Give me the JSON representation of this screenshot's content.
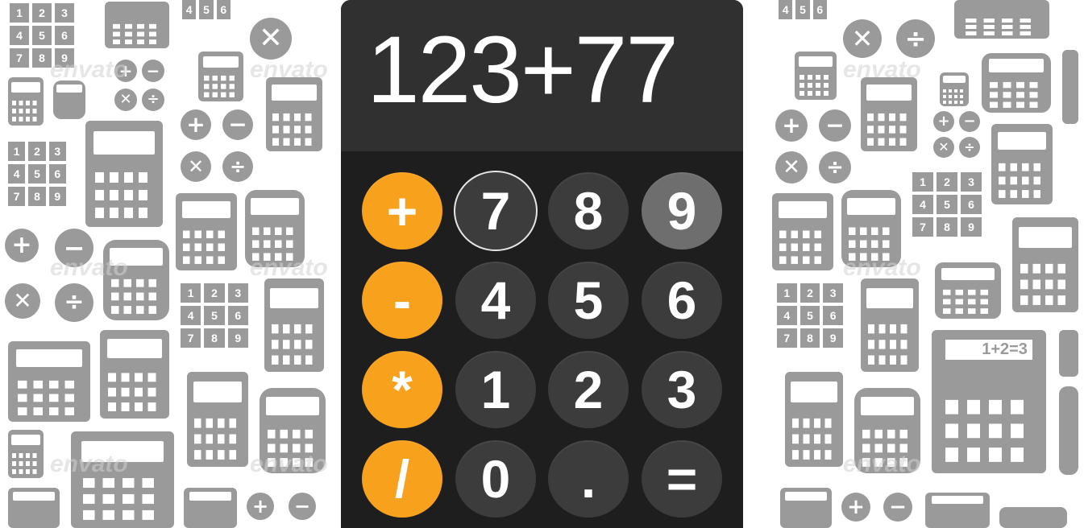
{
  "display": {
    "expression": "123+77"
  },
  "buttons": {
    "plus": "+",
    "minus": "-",
    "multiply": "*",
    "divide": "/",
    "seven": "7",
    "eight": "8",
    "nine": "9",
    "four": "4",
    "five": "5",
    "six": "6",
    "one": "1",
    "two": "2",
    "three": "3",
    "zero": "0",
    "dot": ".",
    "equals": "="
  },
  "background": {
    "watermark": "envato",
    "screen_text": "1+2=3",
    "keys": [
      "1",
      "2",
      "3",
      "4",
      "5",
      "6",
      "7",
      "8",
      "9"
    ]
  },
  "colors": {
    "operator": "#f7a11c",
    "digit": "#3c3c3c",
    "display_bg": "#303030",
    "body_bg": "#1e1e1e",
    "hover_digit": "#6e6e6e"
  }
}
